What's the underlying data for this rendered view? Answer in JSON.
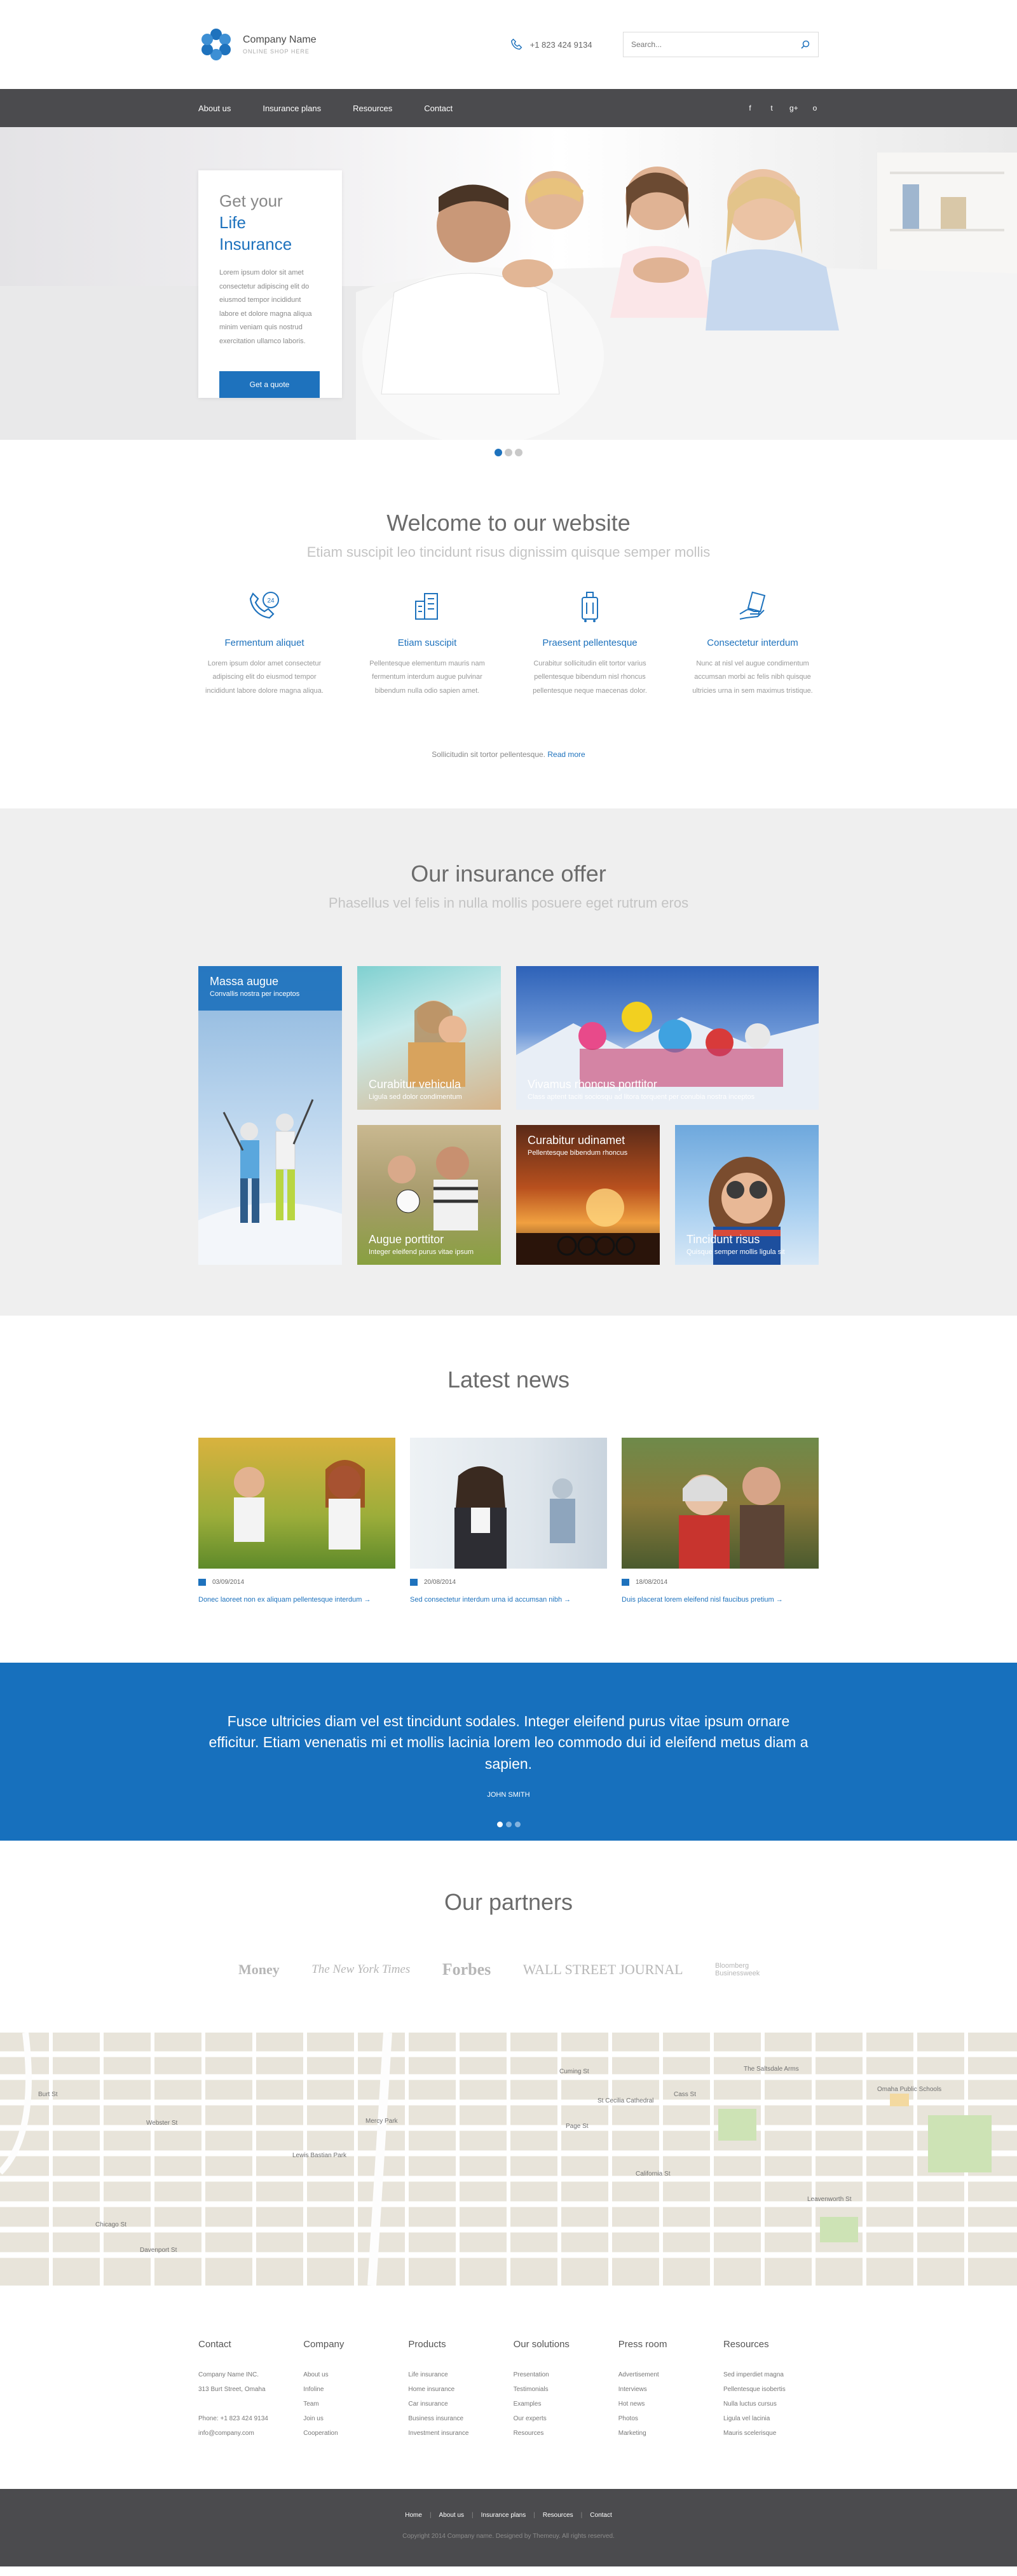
{
  "brand": {
    "name": "Company Name",
    "tagline": "ONLINE SHOP HERE"
  },
  "header": {
    "phone": "+1 823 424 9134",
    "search_placeholder": "Search..."
  },
  "nav": {
    "items": [
      "About us",
      "Insurance plans",
      "Resources",
      "Contact"
    ],
    "social": [
      "f",
      "t",
      "g+",
      "o"
    ]
  },
  "hero": {
    "title_line1": "Get your",
    "title_line2": "Life Insurance",
    "text": "Lorem ipsum dolor sit amet consectetur adipiscing elit do eiusmod tempor incididunt labore et dolore magna aliqua minim veniam quis nostrud exercitation ullamco laboris.",
    "button": "Get a quote",
    "slides": 3,
    "active_slide": 1
  },
  "welcome": {
    "title": "Welcome to our website",
    "subtitle": "Etiam suscipit leo tincidunt risus dignissim quisque semper mollis",
    "features": [
      {
        "icon": "phone-24-icon",
        "title": "Fermentum aliquet",
        "text": "Lorem ipsum dolor amet consectetur adipiscing elit do eiusmod tempor incididunt labore dolore magna aliqua."
      },
      {
        "icon": "building-icon",
        "title": "Etiam suscipit",
        "text": "Pellentesque elementum mauris nam fermentum interdum augue pulvinar bibendum nulla odio sapien amet."
      },
      {
        "icon": "luggage-icon",
        "title": "Praesent pellentesque",
        "text": "Curabitur sollicitudin elit tortor varius pellentesque bibendum nisl rhoncus pellentesque neque maecenas dolor."
      },
      {
        "icon": "hand-document-icon",
        "title": "Consectetur interdum",
        "text": "Nunc at nisl vel augue condimentum accumsan morbi ac felis nibh quisque ultricies urna in sem maximus tristique."
      }
    ],
    "readmore_text": "Sollicitudin sit tortor pellentesque.",
    "readmore_link": "Read more"
  },
  "offer": {
    "title": "Our insurance offer",
    "subtitle": "Phasellus vel felis in nulla mollis posuere eget rutrum eros",
    "tiles": [
      {
        "title": "Massa augue",
        "text": "Convallis nostra per inceptos"
      },
      {
        "title": "Curabitur vehicula",
        "text": "Ligula sed dolor condimentum"
      },
      {
        "title": "Vivamus rhoncus porttitor",
        "text": "Class aptent taciti sociosqu ad litora torquent per conubia nostra inceptos"
      },
      {
        "title": "Augue porttitor",
        "text": "Integer eleifend purus vitae ipsum"
      },
      {
        "title": "Curabitur udinamet",
        "text": "Pellentesque bibendum rhoncus"
      },
      {
        "title": "Tincidunt risus",
        "text": "Quisque semper mollis ligula sit"
      }
    ]
  },
  "news": {
    "title": "Latest news",
    "items": [
      {
        "date": "03/09/2014",
        "link": "Donec laoreet non ex aliquam pellentesque interdum"
      },
      {
        "date": "20/08/2014",
        "link": "Sed consectetur interdum urna id accumsan nibh"
      },
      {
        "date": "18/08/2014",
        "link": "Duis placerat lorem eleifend nisl faucibus pretium"
      }
    ]
  },
  "testimonial": {
    "text": "Fusce ultricies diam vel est tincidunt sodales. Integer eleifend purus vitae ipsum ornare efficitur. Etiam venenatis mi et mollis lacinia lorem leo commodo dui id eleifend metus diam a sapien.",
    "author": "JOHN SMITH",
    "slides": 3,
    "active_slide": 1
  },
  "partners": {
    "title": "Our partners",
    "logos": [
      "Money",
      "The New York Times",
      "Forbes",
      "WALL STREET JOURNAL",
      "Bloomberg Businessweek"
    ]
  },
  "map": {
    "labels": [
      "Cuming St",
      "Burt St",
      "Webster St",
      "California St",
      "Chicago St",
      "Davenport St",
      "Cass St",
      "Leavenworth St",
      "St Cecilia Cathedral",
      "Omaha Public Schools",
      "Mercy Park",
      "Lewis Bastian Park",
      "The Saltsdale Arms",
      "Page St"
    ]
  },
  "footer": {
    "columns": [
      {
        "title": "Contact",
        "items": [
          "Company Name INC.",
          "313 Burt Street, Omaha",
          "",
          "Phone: +1 823 424 9134",
          "info@company.com"
        ]
      },
      {
        "title": "Company",
        "items": [
          "About us",
          "Infoline",
          "Team",
          "Join us",
          "Cooperation"
        ]
      },
      {
        "title": "Products",
        "items": [
          "Life insurance",
          "Home insurance",
          "Car insurance",
          "Business insurance",
          "Investment insurance"
        ]
      },
      {
        "title": "Our solutions",
        "items": [
          "Presentation",
          "Testimonials",
          "Examples",
          "Our experts",
          "Resources"
        ]
      },
      {
        "title": "Press room",
        "items": [
          "Advertisement",
          "Interviews",
          "Hot news",
          "Photos",
          "Marketing"
        ]
      },
      {
        "title": "Resources",
        "items": [
          "Sed imperdiet magna",
          "Pellentesque isobertis",
          "Nulla luctus cursus",
          "Ligula vel lacinia",
          "Mauris scelerisque"
        ]
      }
    ],
    "bottom_nav": [
      "Home",
      "About us",
      "Insurance plans",
      "Resources",
      "Contact"
    ],
    "copyright": "Copyright 2014 Company name. Designed by Themeuy. All rights reserved."
  },
  "colors": {
    "accent": "#1e72bd",
    "nav": "#4b4b4e",
    "offer_bg": "#efefef"
  }
}
